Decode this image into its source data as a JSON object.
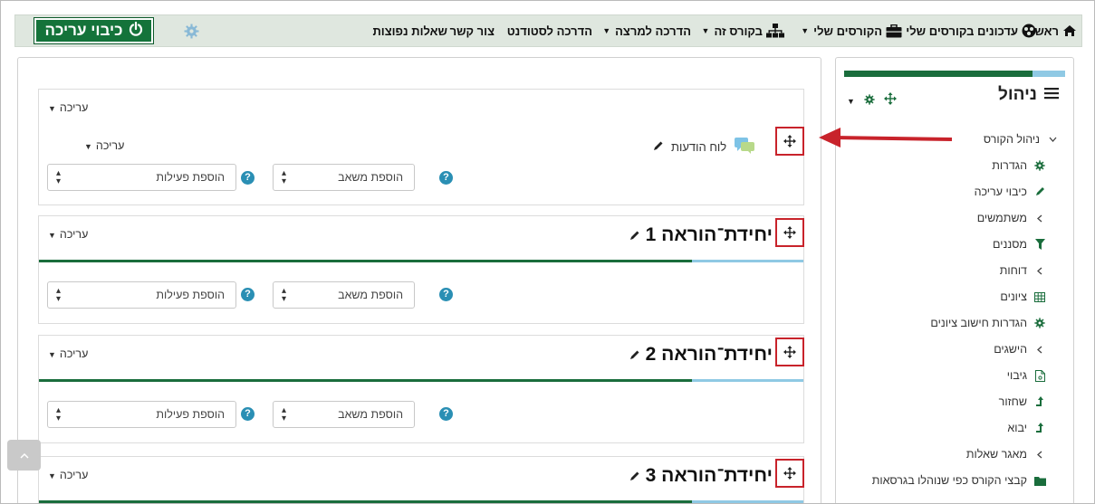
{
  "nav": {
    "home": "ראשי",
    "updates": "עדכונים בקורסים שלי",
    "my_courses": "הקורסים שלי",
    "this_course": "בקורס זה",
    "teacher_guide": "הדרכה למרצה",
    "student_guide": "הדרכה לסטודנט",
    "contact": "צור קשר",
    "faq": "שאלות נפוצות",
    "edit_mode_button": "כיבוי עריכה"
  },
  "sidebar": {
    "title": "ניהול",
    "items": [
      {
        "label": "ניהול הקורס",
        "icon": "chevron-down-icon"
      },
      {
        "label": "הגדרות",
        "icon": "gear-icon"
      },
      {
        "label": "כיבוי עריכה",
        "icon": "pencil-icon"
      },
      {
        "label": "משתמשים",
        "icon": "chevron-left-icon"
      },
      {
        "label": "מסננים",
        "icon": "filter-icon"
      },
      {
        "label": "דוחות",
        "icon": "chevron-left-icon"
      },
      {
        "label": "ציונים",
        "icon": "table-icon"
      },
      {
        "label": "הגדרות חישוב ציונים",
        "icon": "gear-icon"
      },
      {
        "label": "הישגים",
        "icon": "chevron-left-icon"
      },
      {
        "label": "גיבוי",
        "icon": "file-icon"
      },
      {
        "label": "שחזור",
        "icon": "upload-icon"
      },
      {
        "label": "יבוא",
        "icon": "upload-icon"
      },
      {
        "label": "מאגר שאלות",
        "icon": "chevron-left-icon"
      },
      {
        "label": "קבצי הקורס כפי שנוהלו בגרסאות",
        "icon": "folder-icon"
      }
    ]
  },
  "main": {
    "edit_label": "עריכה",
    "add_resource": "הוספת משאב",
    "add_activity": "הוספת פעילות",
    "forum_label": "לוח הודעות",
    "sections": [
      {
        "title": "יחידת־הוראה 1"
      },
      {
        "title": "יחידת־הוראה 2"
      },
      {
        "title": "יחידת־הוראה 3"
      }
    ]
  },
  "colors": {
    "brand_green": "#14733a",
    "accent_blue": "#8fc9e4",
    "highlight_red": "#c8232b"
  }
}
